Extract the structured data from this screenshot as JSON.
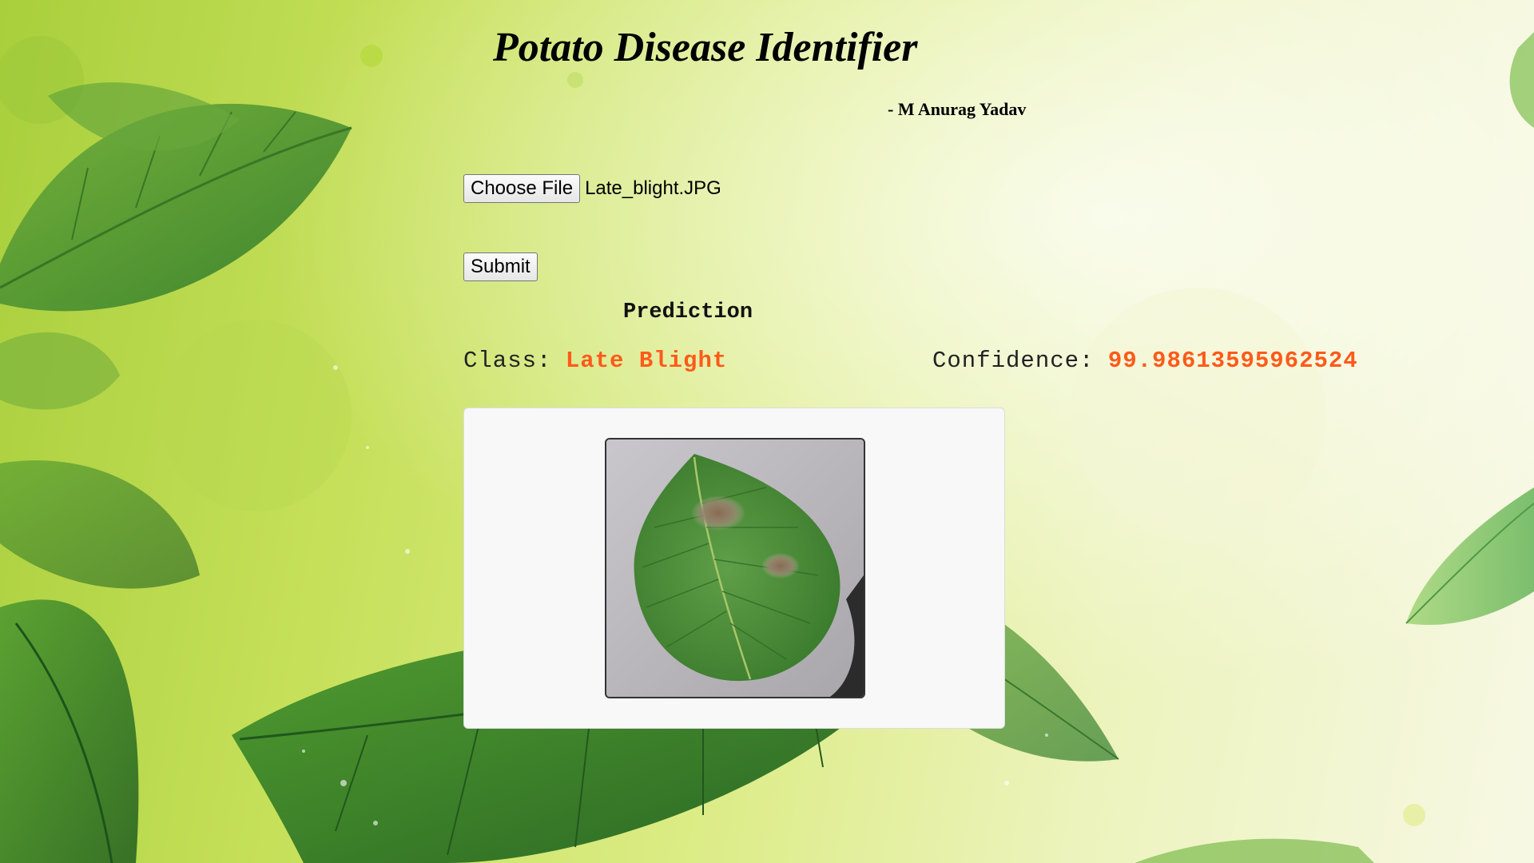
{
  "page": {
    "title": "Potato Disease Identifier",
    "author": "- M Anurag Yadav"
  },
  "upload": {
    "choose_file_label": "Choose File",
    "file_name": "Late_blight.JPG",
    "submit_label": "Submit"
  },
  "prediction": {
    "heading": "Prediction",
    "class_label": "Class:",
    "class_value": "Late Blight",
    "confidence_label": "Confidence:",
    "confidence_value": "99.98613595962524"
  },
  "colors": {
    "result_value": "#ff5a1a",
    "card_background": "#f8f8f8",
    "leaf_green": "#3f8a35"
  },
  "icons": {
    "uploaded_image": "potato-leaf-late-blight-photo"
  }
}
